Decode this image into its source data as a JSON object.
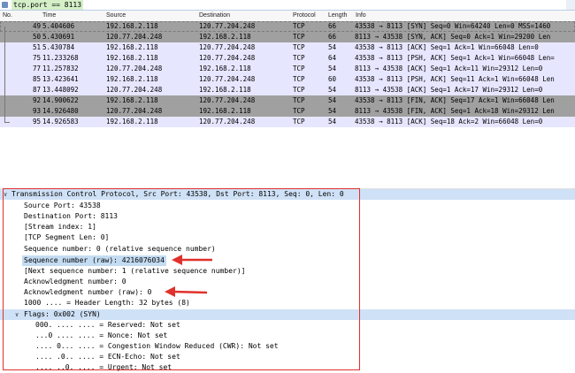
{
  "filter": {
    "text": "tcp.port == 8113"
  },
  "columns": [
    "No.",
    "Time",
    "Source",
    "Destination",
    "Protocol",
    "Length",
    "Info"
  ],
  "packets": [
    {
      "no": "49",
      "time": "5.404606",
      "src": "192.168.2.118",
      "dst": "120.77.204.248",
      "proto": "TCP",
      "len": "66",
      "info": "43538 → 8113 [SYN] Seq=0 Win=64240 Len=0 MSS=1460",
      "style": "syn"
    },
    {
      "no": "50",
      "time": "5.430691",
      "src": "120.77.204.248",
      "dst": "192.168.2.118",
      "proto": "TCP",
      "len": "66",
      "info": "8113 → 43538 [SYN, ACK] Seq=0 Ack=1 Win=29200 Len",
      "style": "syn"
    },
    {
      "no": "51",
      "time": "5.430784",
      "src": "192.168.2.118",
      "dst": "120.77.204.248",
      "proto": "TCP",
      "len": "54",
      "info": "43538 → 8113 [ACK] Seq=1 Ack=1 Win=66048 Len=0",
      "style": "tcp"
    },
    {
      "no": "75",
      "time": "11.233268",
      "src": "192.168.2.118",
      "dst": "120.77.204.248",
      "proto": "TCP",
      "len": "64",
      "info": "43538 → 8113 [PSH, ACK] Seq=1 Ack=1 Win=66048 Len=",
      "style": "tcp"
    },
    {
      "no": "77",
      "time": "11.257832",
      "src": "120.77.204.248",
      "dst": "192.168.2.118",
      "proto": "TCP",
      "len": "54",
      "info": "8113 → 43538 [ACK] Seq=1 Ack=11 Win=29312 Len=0",
      "style": "tcp"
    },
    {
      "no": "85",
      "time": "13.423641",
      "src": "192.168.2.118",
      "dst": "120.77.204.248",
      "proto": "TCP",
      "len": "60",
      "info": "43538 → 8113 [PSH, ACK] Seq=11 Ack=1 Win=66048 Len",
      "style": "tcp"
    },
    {
      "no": "87",
      "time": "13.448092",
      "src": "120.77.204.248",
      "dst": "192.168.2.118",
      "proto": "TCP",
      "len": "54",
      "info": "8113 → 43538 [ACK] Seq=1 Ack=17 Win=29312 Len=0",
      "style": "tcp"
    },
    {
      "no": "92",
      "time": "14.900622",
      "src": "192.168.2.118",
      "dst": "120.77.204.248",
      "proto": "TCP",
      "len": "54",
      "info": "43538 → 8113 [FIN, ACK] Seq=17 Ack=1 Win=66048 Len",
      "style": "syn"
    },
    {
      "no": "93",
      "time": "14.926480",
      "src": "120.77.204.248",
      "dst": "192.168.2.118",
      "proto": "TCP",
      "len": "54",
      "info": "8113 → 43538 [FIN, ACK] Seq=1 Ack=18 Win=29312 Len",
      "style": "syn"
    },
    {
      "no": "95",
      "time": "14.926583",
      "src": "192.168.2.118",
      "dst": "120.77.204.248",
      "proto": "TCP",
      "len": "54",
      "info": "43538 → 8113 [ACK] Seq=18 Ack=2 Win=66048 Len=0",
      "style": "tcp"
    }
  ],
  "details": {
    "header": "Transmission Control Protocol, Src Port: 43538, Dst Port: 8113, Seq: 0, Len: 0",
    "source_port": "Source Port: 43538",
    "destination_port": "Destination Port: 8113",
    "stream_index": "[Stream index: 1]",
    "segment_len": "[TCP Segment Len: 0]",
    "seq_number": "Sequence number: 0    (relative sequence number)",
    "seq_raw": "Sequence number (raw): 4216076034",
    "next_seq": "[Next sequence number: 1    (relative sequence number)]",
    "ack_number": "Acknowledgment number: 0",
    "ack_raw": "Acknowledgment number (raw): 0",
    "header_length": "1000 .... = Header Length: 32 bytes (8)",
    "flags": "Flags: 0x002 (SYN)",
    "flag_reserved": "000. .... .... = Reserved: Not set",
    "flag_nonce": "...0 .... .... = Nonce: Not set",
    "flag_cwr": ".... 0... .... = Congestion Window Reduced (CWR): Not set",
    "flag_ecn": ".... .0.. .... = ECN-Echo: Not set",
    "flag_urgent": ".... ..0. .... = Urgent: Not set"
  },
  "colors": {
    "syn_row": "#a0a0a0",
    "tcp_row": "#e7e6ff",
    "annotation": "#e0312c",
    "highlight": "#c4dcf2"
  }
}
